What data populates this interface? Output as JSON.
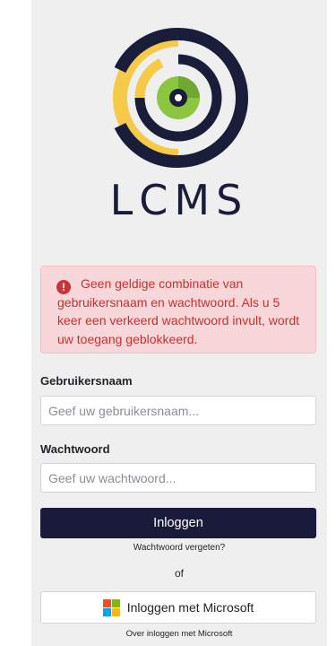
{
  "brand": {
    "name": "LCMS",
    "colors": {
      "navy": "#1a1d3a",
      "yellow": "#f7c948",
      "green": "#8cc63f"
    }
  },
  "alert": {
    "icon": "exclamation-circle-icon",
    "line1": "Geen geldige combinatie van",
    "line2": "gebruikersnaam en wachtwoord. Als u 5 keer een verkeerd wachtwoord invult, wordt uw toegang geblokkeerd.",
    "color": "#c9302c",
    "background": "#f8d7da"
  },
  "form": {
    "username_label": "Gebruikersnaam",
    "username_placeholder": "Geef uw gebruikersnaam...",
    "username_value": "",
    "password_label": "Wachtwoord",
    "password_placeholder": "Geef uw wachtwoord...",
    "password_value": "",
    "login_button": "Inloggen",
    "forgot_link": "Wachtwoord vergeten?",
    "or_text": "of",
    "microsoft_button": "Inloggen met Microsoft",
    "microsoft_icon": "microsoft-logo-icon",
    "microsoft_info_link": "Over inloggen met Microsoft"
  }
}
